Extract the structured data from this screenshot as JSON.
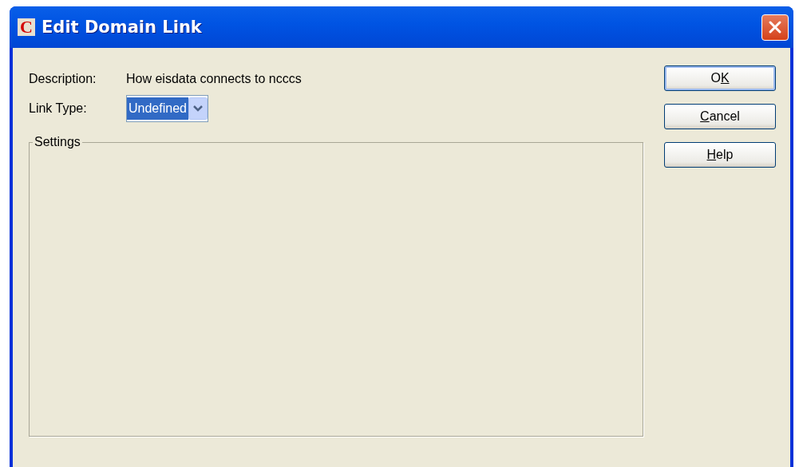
{
  "window": {
    "title": "Edit Domain Link",
    "app_icon_letter": "C"
  },
  "fields": [
    {
      "kind": "text",
      "label": "Description:",
      "value": "How eisdata connects to ncccs"
    },
    {
      "kind": "dropdown",
      "label": "Link Type:",
      "value": "Undefined",
      "focused": true
    }
  ],
  "group": {
    "title": "Settings"
  },
  "buttons": [
    {
      "parts": [
        {
          "text": "O",
          "underline": false
        },
        {
          "text": "K",
          "underline": true
        }
      ],
      "default": true
    },
    {
      "parts": [
        {
          "text": "C",
          "underline": true
        },
        {
          "text": "ancel",
          "underline": false
        }
      ],
      "default": false
    },
    {
      "parts": [
        {
          "text": "H",
          "underline": true
        },
        {
          "text": "elp",
          "underline": false
        }
      ],
      "default": false
    }
  ]
}
